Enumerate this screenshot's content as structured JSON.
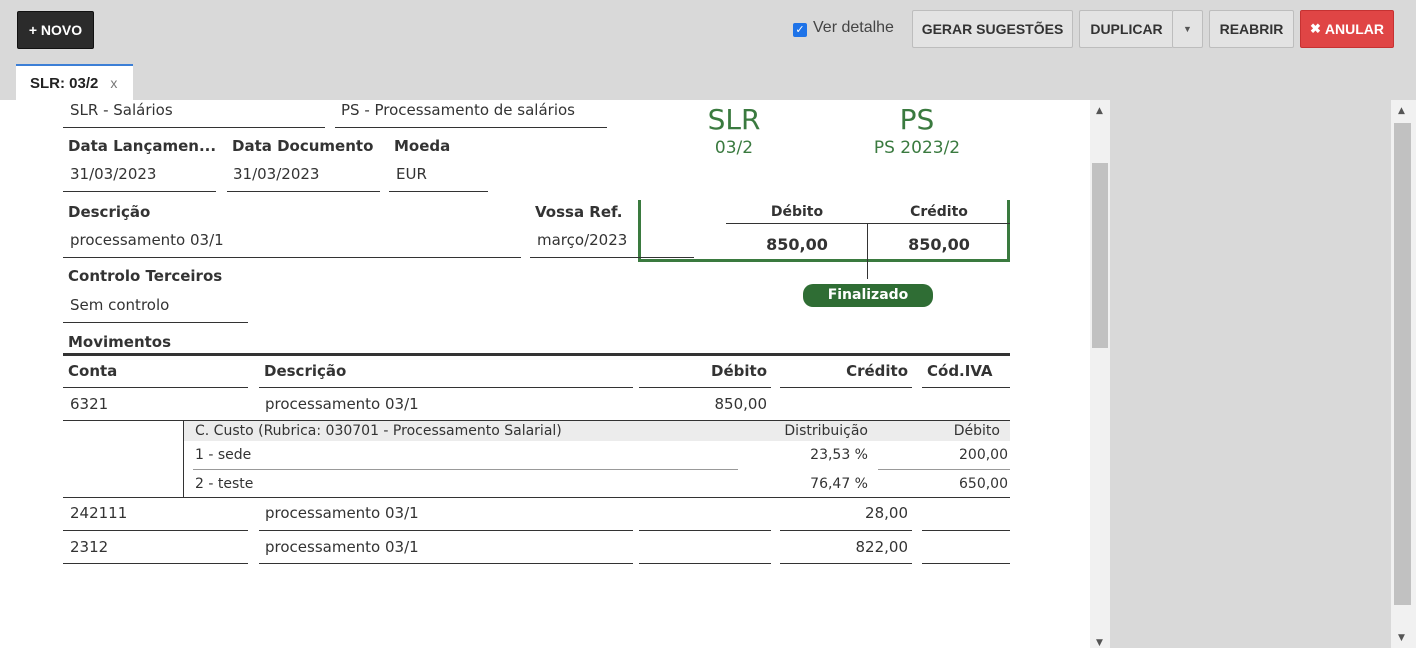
{
  "toolbar": {
    "novo": "+ NOVO",
    "ver_detalhe": "Ver detalhe",
    "gerar": "GERAR SUGESTÕES",
    "duplicar": "DUPLICAR",
    "reabrir": "REABRIR",
    "anular": "ANULAR"
  },
  "tab": {
    "label": "SLR: 03/2",
    "close": "x"
  },
  "header": {
    "diario": "SLR - Salários",
    "tipo": "PS - Processamento de salários",
    "data_lanc_label": "Data Lançamen...",
    "data_lanc": "31/03/2023",
    "data_doc_label": "Data Documento",
    "data_doc": "31/03/2023",
    "moeda_label": "Moeda",
    "moeda": "EUR",
    "descricao_label": "Descrição",
    "descricao": "processamento 03/1",
    "vossa_ref_label": "Vossa Ref.",
    "vossa_ref": "março/2023",
    "controlo_label": "Controlo Terceiros",
    "controlo": "Sem controlo"
  },
  "stamp": {
    "left_code": "SLR",
    "left_num": "03/2",
    "right_code": "PS",
    "right_num": "PS 2023/2"
  },
  "totals": {
    "debito_label": "Débito",
    "credito_label": "Crédito",
    "debito": "850,00",
    "credito": "850,00"
  },
  "status": "Finalizado",
  "movimentos": {
    "title": "Movimentos",
    "cols": {
      "conta": "Conta",
      "descricao": "Descrição",
      "debito": "Débito",
      "credito": "Crédito",
      "iva": "Cód.IVA"
    },
    "rows": [
      {
        "conta": "6321",
        "descricao": "processamento 03/1",
        "debito": "850,00",
        "credito": ""
      },
      {
        "conta": "242111",
        "descricao": "processamento 03/1",
        "debito": "",
        "credito": "28,00"
      },
      {
        "conta": "2312",
        "descricao": "processamento 03/1",
        "debito": "",
        "credito": "822,00"
      }
    ],
    "centro_custo": {
      "header": "C. Custo (Rubrica: 030701 - Processamento Salarial)",
      "dist_label": "Distribuição",
      "deb_label": "Débito",
      "items": [
        {
          "nome": "1 - sede",
          "dist": "23,53 %",
          "valor": "200,00"
        },
        {
          "nome": "2 - teste",
          "dist": "76,47 %",
          "valor": "650,00"
        }
      ]
    }
  }
}
